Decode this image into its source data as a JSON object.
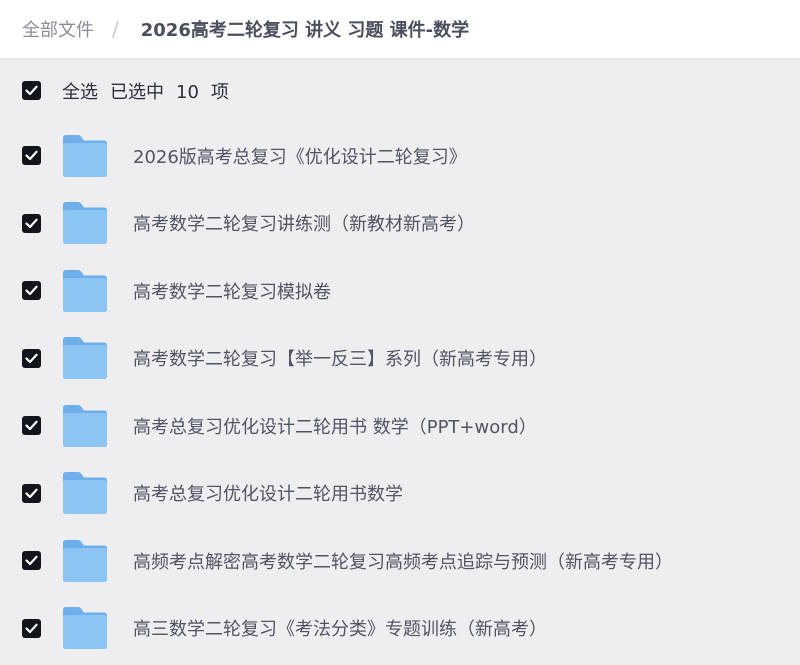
{
  "breadcrumb": {
    "root": "全部文件",
    "separator": "/",
    "current": "2026高考二轮复习 讲义 习题 课件-数学"
  },
  "selection": {
    "select_all": "全选",
    "selected_prefix": "已选中",
    "count": "10",
    "unit": "项"
  },
  "items": [
    {
      "name": "2026版高考总复习《优化设计二轮复习》"
    },
    {
      "name": "高考数学二轮复习讲练测（新教材新高考）"
    },
    {
      "name": "高考数学二轮复习模拟卷"
    },
    {
      "name": "高考数学二轮复习【举一反三】系列（新高考专用）"
    },
    {
      "name": "高考总复习优化设计二轮用书 数学（PPT+word）"
    },
    {
      "name": "高考总复习优化设计二轮用书数学"
    },
    {
      "name": "高频考点解密高考数学二轮复习高频考点追踪与预测（新高考专用）"
    },
    {
      "name": "高三数学二轮复习《考法分类》专题训练（新高考）"
    }
  ],
  "colors": {
    "checkbox": "#14151c",
    "folder": "#7bb8ef",
    "background": "#eeeef1"
  },
  "icons": {
    "checkbox": "check-icon",
    "folder": "folder-icon"
  }
}
